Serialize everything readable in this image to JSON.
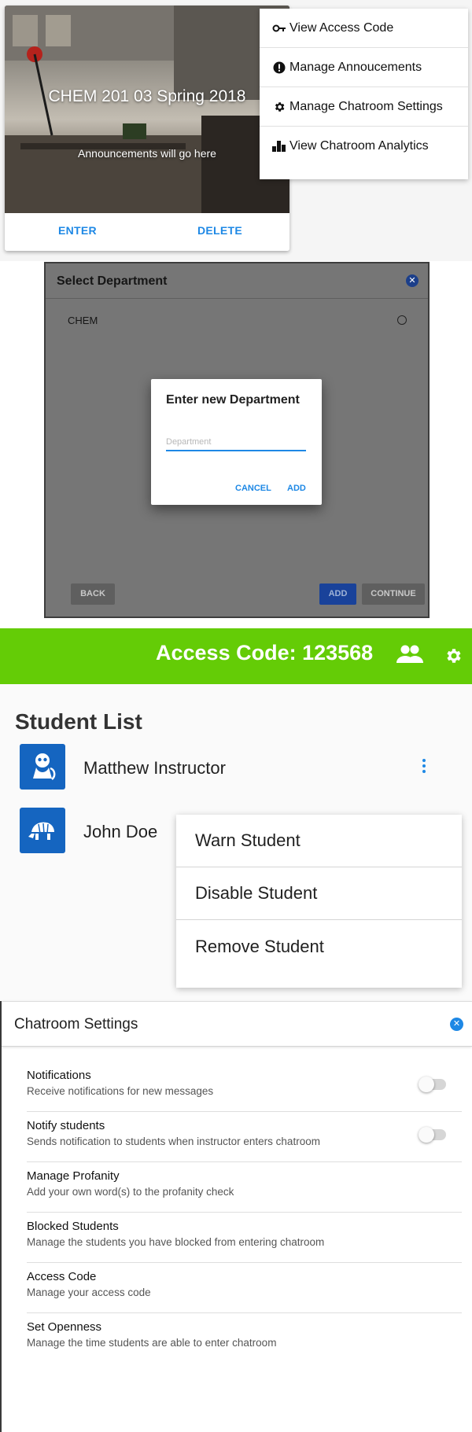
{
  "course_card": {
    "title": "CHEM 201 03 Spring 2018",
    "announcement": "Announcements will go here",
    "enter_label": "ENTER",
    "delete_label": "DELETE"
  },
  "course_menu": {
    "items": [
      {
        "label": "View Access Code",
        "icon": "key-icon"
      },
      {
        "label": "Manage Annoucements",
        "icon": "alert-circle-icon"
      },
      {
        "label": "Manage Chatroom Settings",
        "icon": "gear-icon"
      },
      {
        "label": "View Chatroom Analytics",
        "icon": "bar-chart-icon"
      }
    ]
  },
  "department_modal": {
    "title": "Select Department",
    "items": [
      "CHEM"
    ],
    "back_label": "BACK",
    "add_label": "ADD",
    "continue_label": "CONTINUE"
  },
  "new_department_dialog": {
    "title": "Enter new Department",
    "placeholder": "Department",
    "value": "",
    "cancel_label": "CANCEL",
    "add_label": "ADD"
  },
  "student_screen": {
    "access_code_label": "Access Code: 123568",
    "heading": "Student List",
    "students": [
      {
        "name": "Matthew Instructor",
        "avatar": "lemur-avatar-icon"
      },
      {
        "name": "John Doe",
        "avatar": "armadillo-avatar-icon"
      }
    ],
    "menu_items": [
      "Warn Student",
      "Disable Student",
      "Remove Student"
    ]
  },
  "chatroom_settings": {
    "title": "Chatroom Settings",
    "items": [
      {
        "title": "Notifications",
        "subtitle": "Receive notifications for new messages",
        "toggle": false
      },
      {
        "title": "Notify students",
        "subtitle": "Sends notification to students when instructor enters chatroom",
        "toggle": false
      },
      {
        "title": "Manage Profanity",
        "subtitle": "Add your own word(s) to the profanity check"
      },
      {
        "title": "Blocked Students",
        "subtitle": "Manage the students you have blocked from entering chatroom"
      },
      {
        "title": "Access Code",
        "subtitle": "Manage your access code"
      },
      {
        "title": "Set Openness",
        "subtitle": "Manage the time students are able to enter chatroom"
      }
    ]
  },
  "colors": {
    "accent_blue": "#1e88e5",
    "topbar_green": "#64cc06",
    "avatar_blue": "#1565c0"
  }
}
